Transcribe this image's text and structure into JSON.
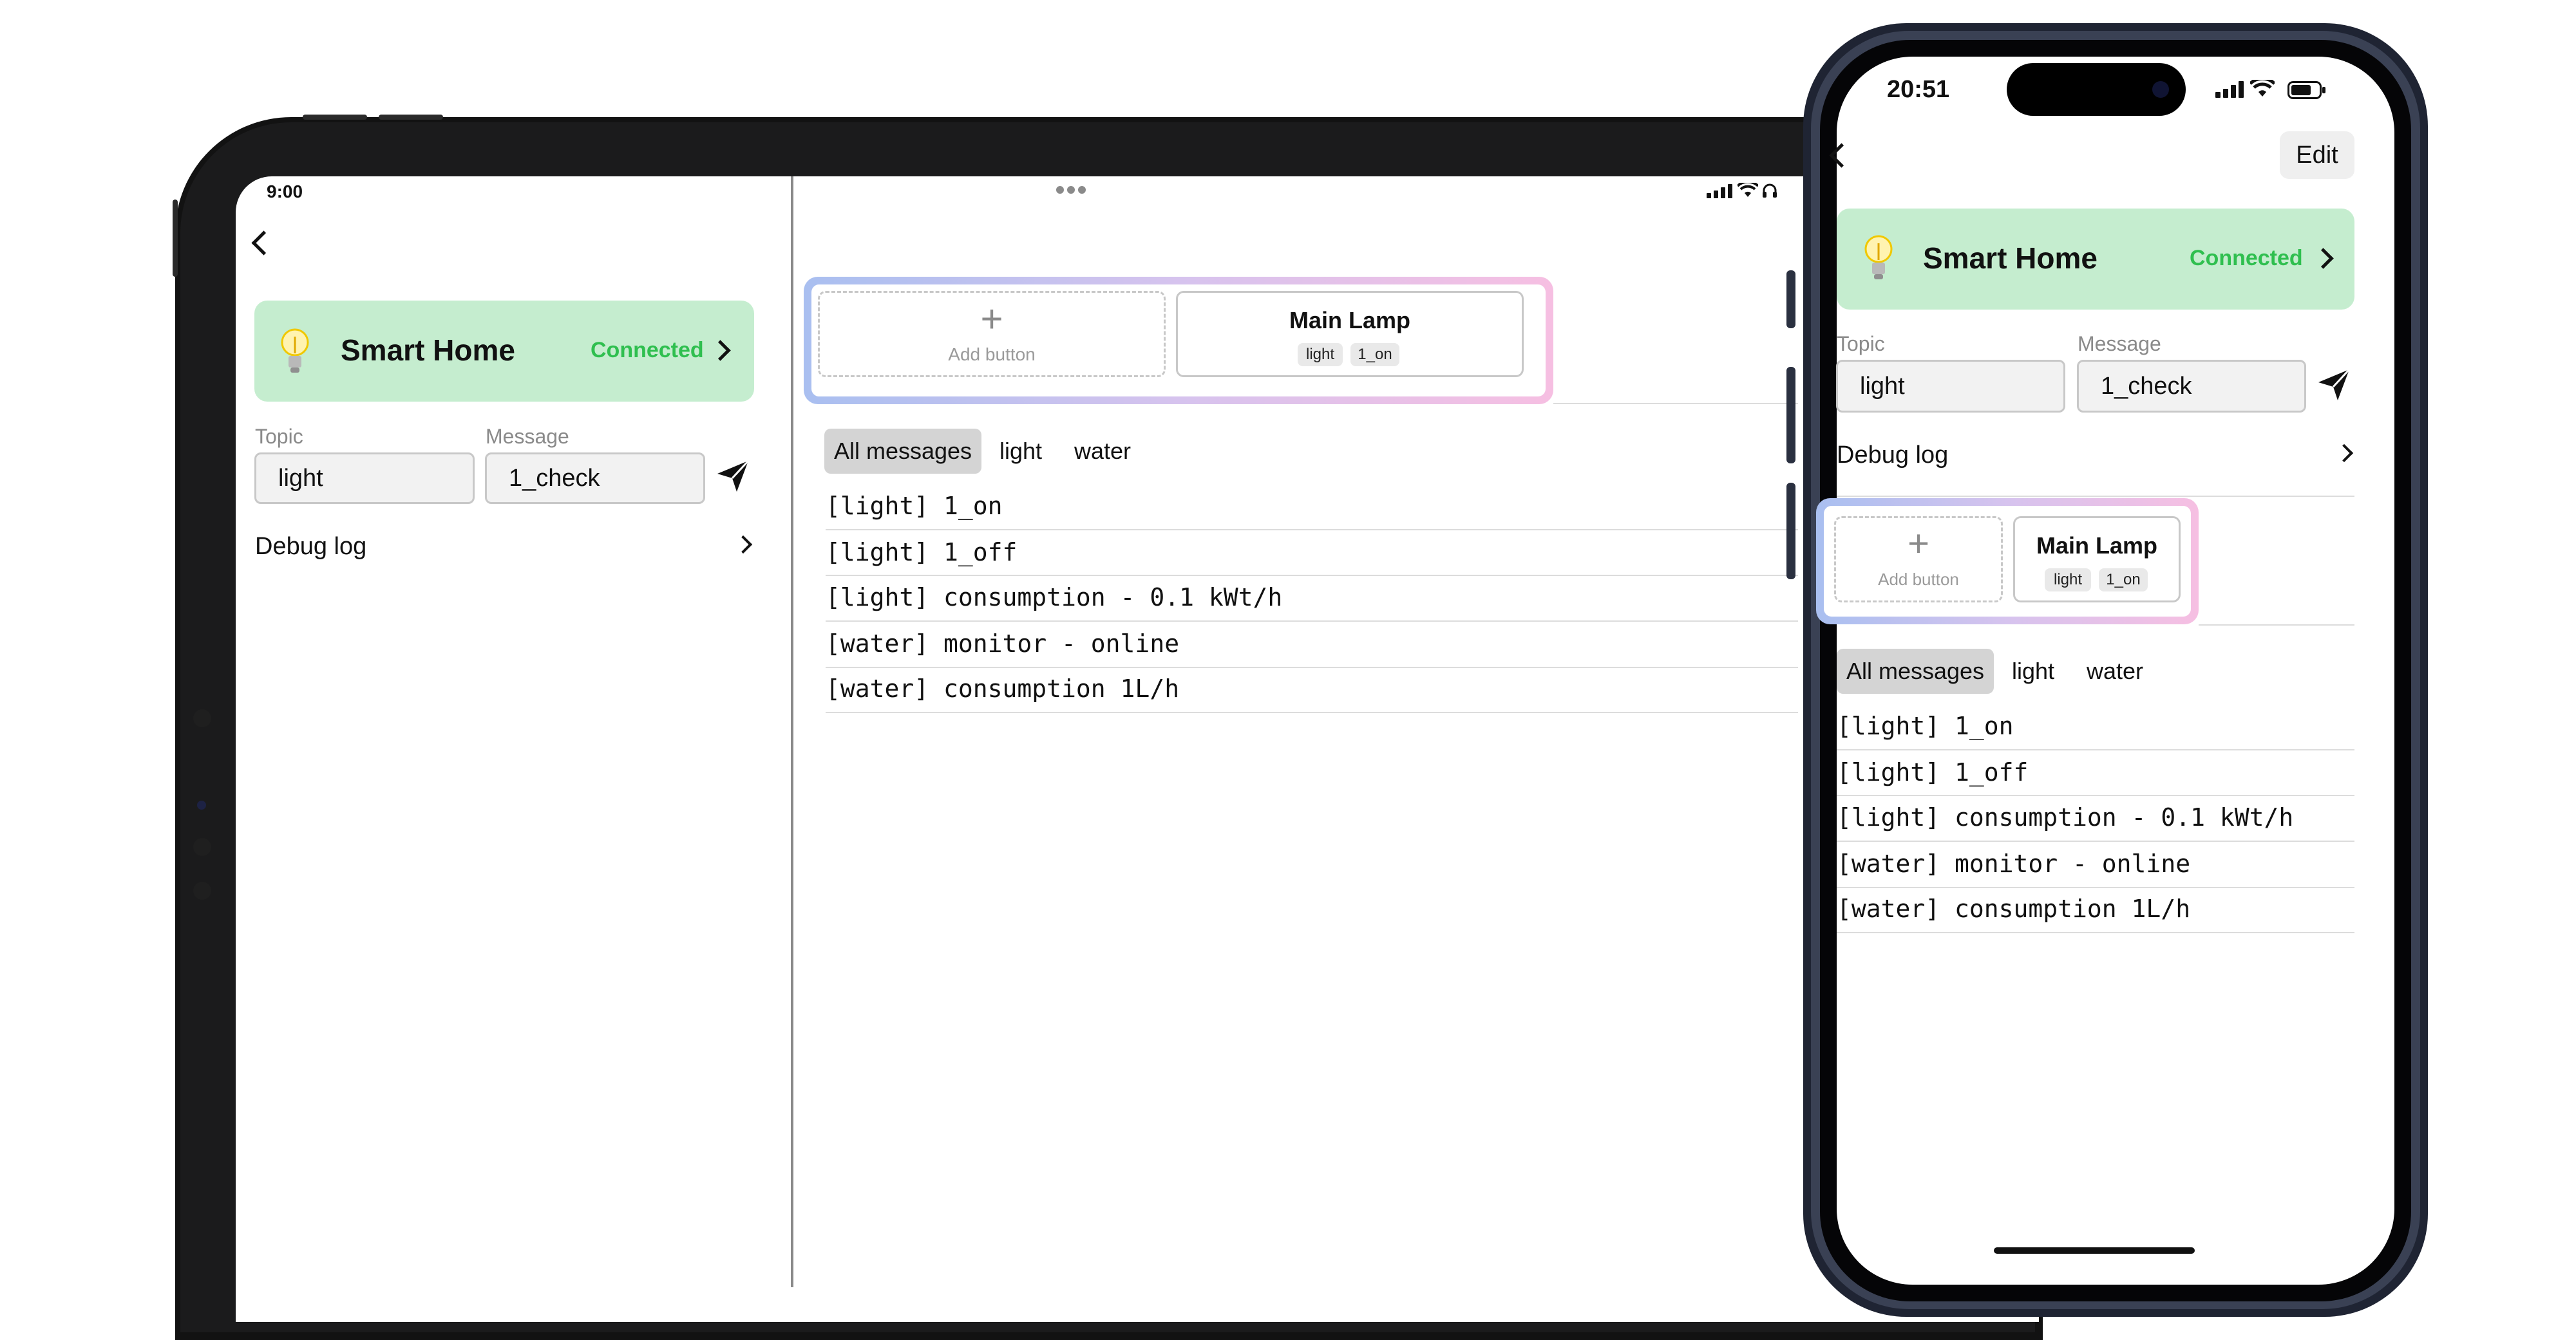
{
  "ipad": {
    "status": {
      "time": "9:00"
    },
    "home_card": {
      "title": "Smart Home",
      "status": "Connected"
    },
    "composer": {
      "topic_label": "Topic",
      "topic_value": "light",
      "message_label": "Message",
      "message_value": "1_check"
    },
    "debug_log_label": "Debug log",
    "buttons": {
      "add_label": "Add button",
      "lamp_title": "Main Lamp",
      "lamp_tags": [
        "light",
        "1_on"
      ]
    },
    "tabs": [
      "All messages",
      "light",
      "water"
    ],
    "log": [
      "[light] 1_on",
      "[light] 1_off",
      "[light] consumption - 0.1 kWt/h",
      "[water] monitor - online",
      "[water] consumption 1L/h"
    ]
  },
  "iphone": {
    "status": {
      "time": "20:51"
    },
    "nav": {
      "edit_label": "Edit"
    },
    "home_card": {
      "title": "Smart Home",
      "status": "Connected"
    },
    "composer": {
      "topic_label": "Topic",
      "topic_value": "light",
      "message_label": "Message",
      "message_value": "1_check"
    },
    "debug_log_label": "Debug log",
    "buttons": {
      "add_label": "Add button",
      "lamp_title": "Main Lamp",
      "lamp_tags": [
        "light",
        "1_on"
      ]
    },
    "tabs": [
      "All messages",
      "light",
      "water"
    ],
    "log": [
      "[light] 1_on",
      "[light] 1_off",
      "[light] consumption - 0.1 kWt/h",
      "[water] monitor - online",
      "[water] consumption 1L/h"
    ]
  },
  "icons": {
    "bulb": "lightbulb-icon",
    "send": "paper-plane-icon",
    "back": "chevron-left-icon",
    "forward": "chevron-right-icon",
    "add": "plus-icon"
  },
  "colors": {
    "connected": "#2fbf4f",
    "card_bg": "#c5edcf",
    "frame_gradient_start": "#a9bff0",
    "frame_gradient_end": "#f6bfe2"
  }
}
